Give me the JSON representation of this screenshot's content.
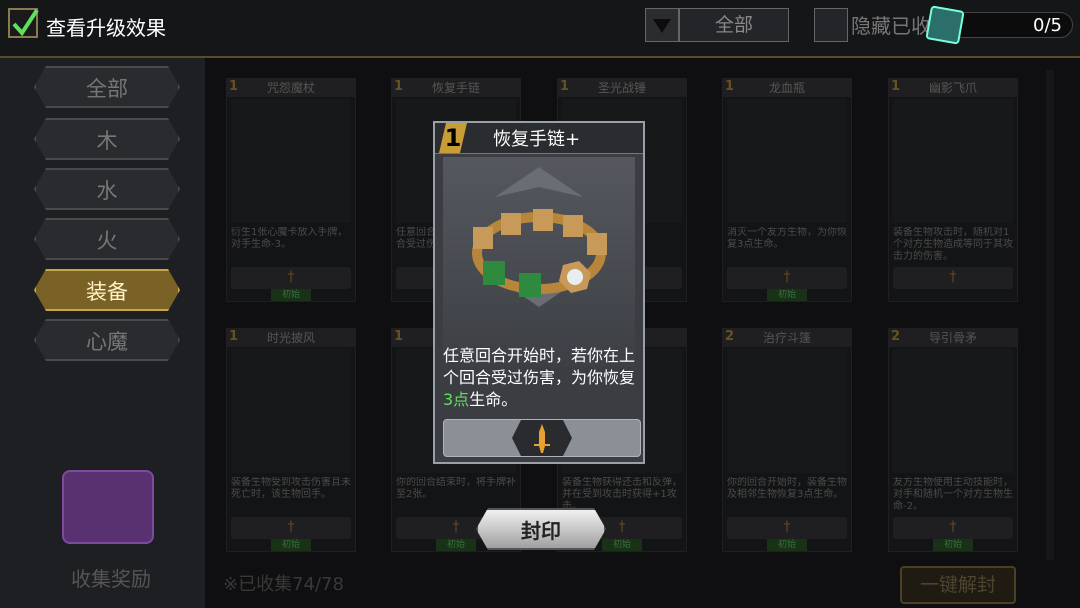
{
  "header": {
    "show_upgrade_label": "查看升级效果",
    "filter_value": "全部",
    "hide_label": "隐藏已收",
    "counter": "0/5"
  },
  "sidebar": {
    "items": [
      {
        "label": "全部"
      },
      {
        "label": "木"
      },
      {
        "label": "水"
      },
      {
        "label": "火"
      },
      {
        "label": "装备"
      },
      {
        "label": "心魔"
      }
    ],
    "collect_reward": "收集奖励"
  },
  "footer": {
    "collected": "※已收集74/78",
    "unlock_all": "一键解封"
  },
  "cards": [
    {
      "cost": "1",
      "name": "咒怨魔杖",
      "desc": "衍生1张心魔卡放入手牌，对手生命-3。",
      "tag": "初始"
    },
    {
      "cost": "1",
      "name": "恢复手链",
      "desc": "任意回合开始时，在上个回合受过伤害，为你恢复",
      "tag": "初始"
    },
    {
      "cost": "1",
      "name": "圣光战锤",
      "desc": "+1。",
      "tag": "初始"
    },
    {
      "cost": "1",
      "name": "龙血瓶",
      "desc": "消灭一个友方生物，为你恢复3点生命。",
      "tag": "初始"
    },
    {
      "cost": "1",
      "name": "幽影飞爪",
      "desc": "装备生物攻击时，随机对1个对方生物造成等同于其攻击力的伤害。",
      "tag": ""
    },
    {
      "cost": "1",
      "name": "时光披风",
      "desc": "装备生物受到攻击伤害且未死亡时，该生物回手。",
      "tag": "初始"
    },
    {
      "cost": "1",
      "name": "",
      "desc": "你的回合结束时，将手牌补至2张。",
      "tag": "初始"
    },
    {
      "cost": "",
      "name": "",
      "desc": "装备生物获得还击和反弹，并在受到攻击时获得+1攻击。",
      "tag": "初始"
    },
    {
      "cost": "2",
      "name": "治疗斗篷",
      "desc": "你的回合开始时，装备生物及相邻生物恢复3点生命。",
      "tag": "初始"
    },
    {
      "cost": "2",
      "name": "导引骨矛",
      "desc": "友方生物使用主动技能时，对手和随机一个对方生物生命-2。",
      "tag": "初始"
    }
  ],
  "popup": {
    "cost": "1",
    "title": "恢复手链+",
    "desc_part1": "任意回合开始时，若你在上个回合受过伤害，为你恢复",
    "desc_highlight": "3点",
    "desc_part2": "生命。",
    "seal_label": "封印"
  }
}
